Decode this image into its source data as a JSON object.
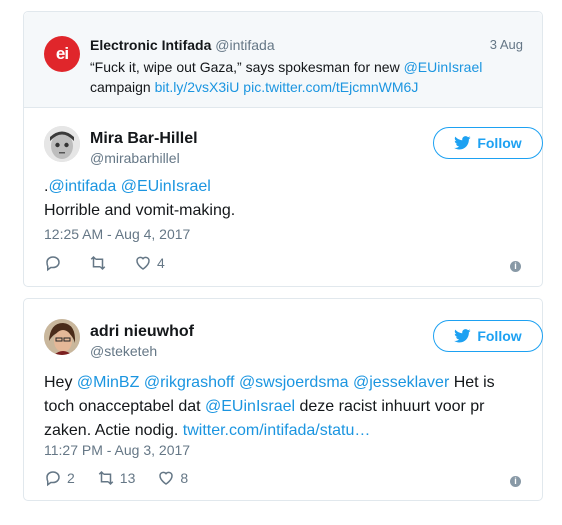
{
  "quoted_tweet": {
    "logo_text": "ei",
    "name": "Electronic Intifada",
    "handle": "@intifada",
    "date": "3 Aug",
    "text_part1": "“Fuck it, wipe out Gaza,” says spokesman for new ",
    "mention": "@EUinIsrael",
    "text_part2": "campaign ",
    "link": "bit.ly/2vsX3iU",
    "pic_link": "pic.twitter.com/tEjcmnWM6J"
  },
  "tweet1": {
    "name": "Mira Bar-Hillel",
    "handle": "@mirabarhillel",
    "follow_label": "Follow",
    "text_prefix": ".",
    "mention1": "@intifada",
    "mention2": "@EUinIsrael",
    "line2": "Horrible and vomit-making.",
    "timestamp": "12:25 AM - Aug 4, 2017",
    "reply_count": "",
    "retweet_count": "",
    "like_count": "4"
  },
  "tweet2": {
    "name": "adri nieuwhof",
    "handle": "@steketeh",
    "follow_label": "Follow",
    "hey": "Hey ",
    "mention1": "@MinBZ",
    "mention2": "@rikgrashoff",
    "mention3": "@swsjoerdsma",
    "mention4": "@jesseklaver",
    "text1": " Het is",
    "text2": "toch onacceptabel dat ",
    "mention5": "@EUinIsrael",
    "text3": " deze racist inhuurt voor pr",
    "text4": "zaken. Actie nodig. ",
    "link": "twitter.com/intifada/statu…",
    "timestamp": "11:27 PM - Aug 3, 2017",
    "reply_count": "2",
    "retweet_count": "13",
    "like_count": "8"
  },
  "colors": {
    "accent": "#1da1f2",
    "link": "#1b95e0",
    "secondary_text": "#657786",
    "ei_red": "#e0262b"
  }
}
